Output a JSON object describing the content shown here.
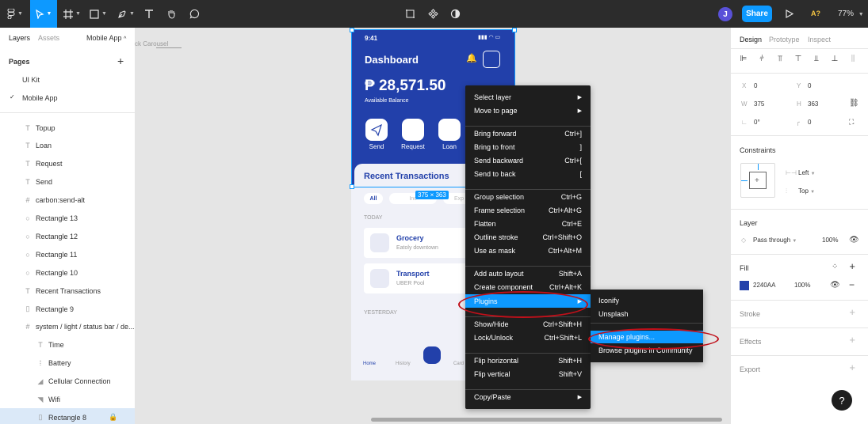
{
  "toolbar": {
    "share_label": "Share",
    "user_initial": "J",
    "assistant_badge": "A?",
    "zoom_label": "77%"
  },
  "left_panel": {
    "tabs": [
      "Layers",
      "Assets"
    ],
    "page_selector": "Mobile App",
    "pages_title": "Pages",
    "pages": [
      "UI Kit",
      "Mobile App"
    ],
    "layers": [
      {
        "icon": "text",
        "label": "Topup"
      },
      {
        "icon": "text",
        "label": "Loan"
      },
      {
        "icon": "text",
        "label": "Request"
      },
      {
        "icon": "text",
        "label": "Send"
      },
      {
        "icon": "frame",
        "label": "carbon:send-alt"
      },
      {
        "icon": "ellipse",
        "label": "Rectangle 13"
      },
      {
        "icon": "ellipse",
        "label": "Rectangle 12"
      },
      {
        "icon": "ellipse",
        "label": "Rectangle 11"
      },
      {
        "icon": "ellipse",
        "label": "Rectangle 10"
      },
      {
        "icon": "text",
        "label": "Recent Transactions"
      },
      {
        "icon": "rect",
        "label": "Rectangle 9"
      },
      {
        "icon": "frame",
        "label": "system / light / status bar / de..."
      },
      {
        "icon": "text",
        "label": "Time"
      },
      {
        "icon": "group",
        "label": "Battery"
      },
      {
        "icon": "signal",
        "label": "Cellular Connection"
      },
      {
        "icon": "wifi",
        "label": "Wifi"
      },
      {
        "icon": "rect",
        "label": "Rectangle 8"
      }
    ]
  },
  "canvas": {
    "carousel_label": "ck Carousel",
    "selection_dims": "375 × 363",
    "phone": {
      "time": "9:41",
      "title": "Dashboard",
      "balance": "₱ 28,571.50",
      "balance_label": "Available Balance",
      "quick_actions": [
        "Send",
        "Request",
        "Loan"
      ],
      "recent_title": "Recent Transactions",
      "filters": [
        "All",
        "Inc",
        "Exp"
      ],
      "today_label": "TODAY",
      "transactions": [
        {
          "title": "Grocery",
          "subtitle": "Eatoly downtown"
        },
        {
          "title": "Transport",
          "subtitle": "UBER Pool"
        }
      ],
      "yesterday_label": "YESTERDAY",
      "nav": [
        "Home",
        "History",
        "Card"
      ]
    }
  },
  "context_menu": {
    "items": [
      {
        "label": "Select layer",
        "shortcut": "▶"
      },
      {
        "label": "Move to page",
        "shortcut": "▶"
      },
      {
        "label": "Bring forward",
        "shortcut": "Ctrl+]"
      },
      {
        "label": "Bring to front",
        "shortcut": "]"
      },
      {
        "label": "Send backward",
        "shortcut": "Ctrl+["
      },
      {
        "label": "Send to back",
        "shortcut": "["
      },
      {
        "label": "Group selection",
        "shortcut": "Ctrl+G"
      },
      {
        "label": "Frame selection",
        "shortcut": "Ctrl+Alt+G"
      },
      {
        "label": "Flatten",
        "shortcut": "Ctrl+E"
      },
      {
        "label": "Outline stroke",
        "shortcut": "Ctrl+Shift+O"
      },
      {
        "label": "Use as mask",
        "shortcut": "Ctrl+Alt+M"
      },
      {
        "label": "Add auto layout",
        "shortcut": "Shift+A"
      },
      {
        "label": "Create component",
        "shortcut": "Ctrl+Alt+K"
      },
      {
        "label": "Plugins",
        "shortcut": "▶"
      },
      {
        "label": "Show/Hide",
        "shortcut": "Ctrl+Shift+H"
      },
      {
        "label": "Lock/Unlock",
        "shortcut": "Ctrl+Shift+L"
      },
      {
        "label": "Flip horizontal",
        "shortcut": "Shift+H"
      },
      {
        "label": "Flip vertical",
        "shortcut": "Shift+V"
      },
      {
        "label": "Copy/Paste",
        "shortcut": "▶"
      }
    ],
    "plugins_submenu": [
      "Iconify",
      "Unsplash",
      "Manage plugins...",
      "Browse plugins in Community"
    ]
  },
  "right_panel": {
    "tabs": [
      "Design",
      "Prototype",
      "Inspect"
    ],
    "x_label": "X",
    "x": "0",
    "y_label": "Y",
    "y": "0",
    "w_label": "W",
    "w": "375",
    "h_label": "H",
    "h": "363",
    "rotation": "0°",
    "radius": "0",
    "constraints_title": "Constraints",
    "constraint_h": "Left",
    "constraint_v": "Top",
    "layer_title": "Layer",
    "blend_mode": "Pass through",
    "layer_opacity": "100%",
    "fill_title": "Fill",
    "fill_hex": "2240AA",
    "fill_opacity": "100%",
    "stroke_title": "Stroke",
    "effects_title": "Effects",
    "export_title": "Export"
  },
  "colors": {
    "accent": "#0d99ff",
    "fill_swatch": "#2240aa",
    "annotation": "#c0101a"
  }
}
